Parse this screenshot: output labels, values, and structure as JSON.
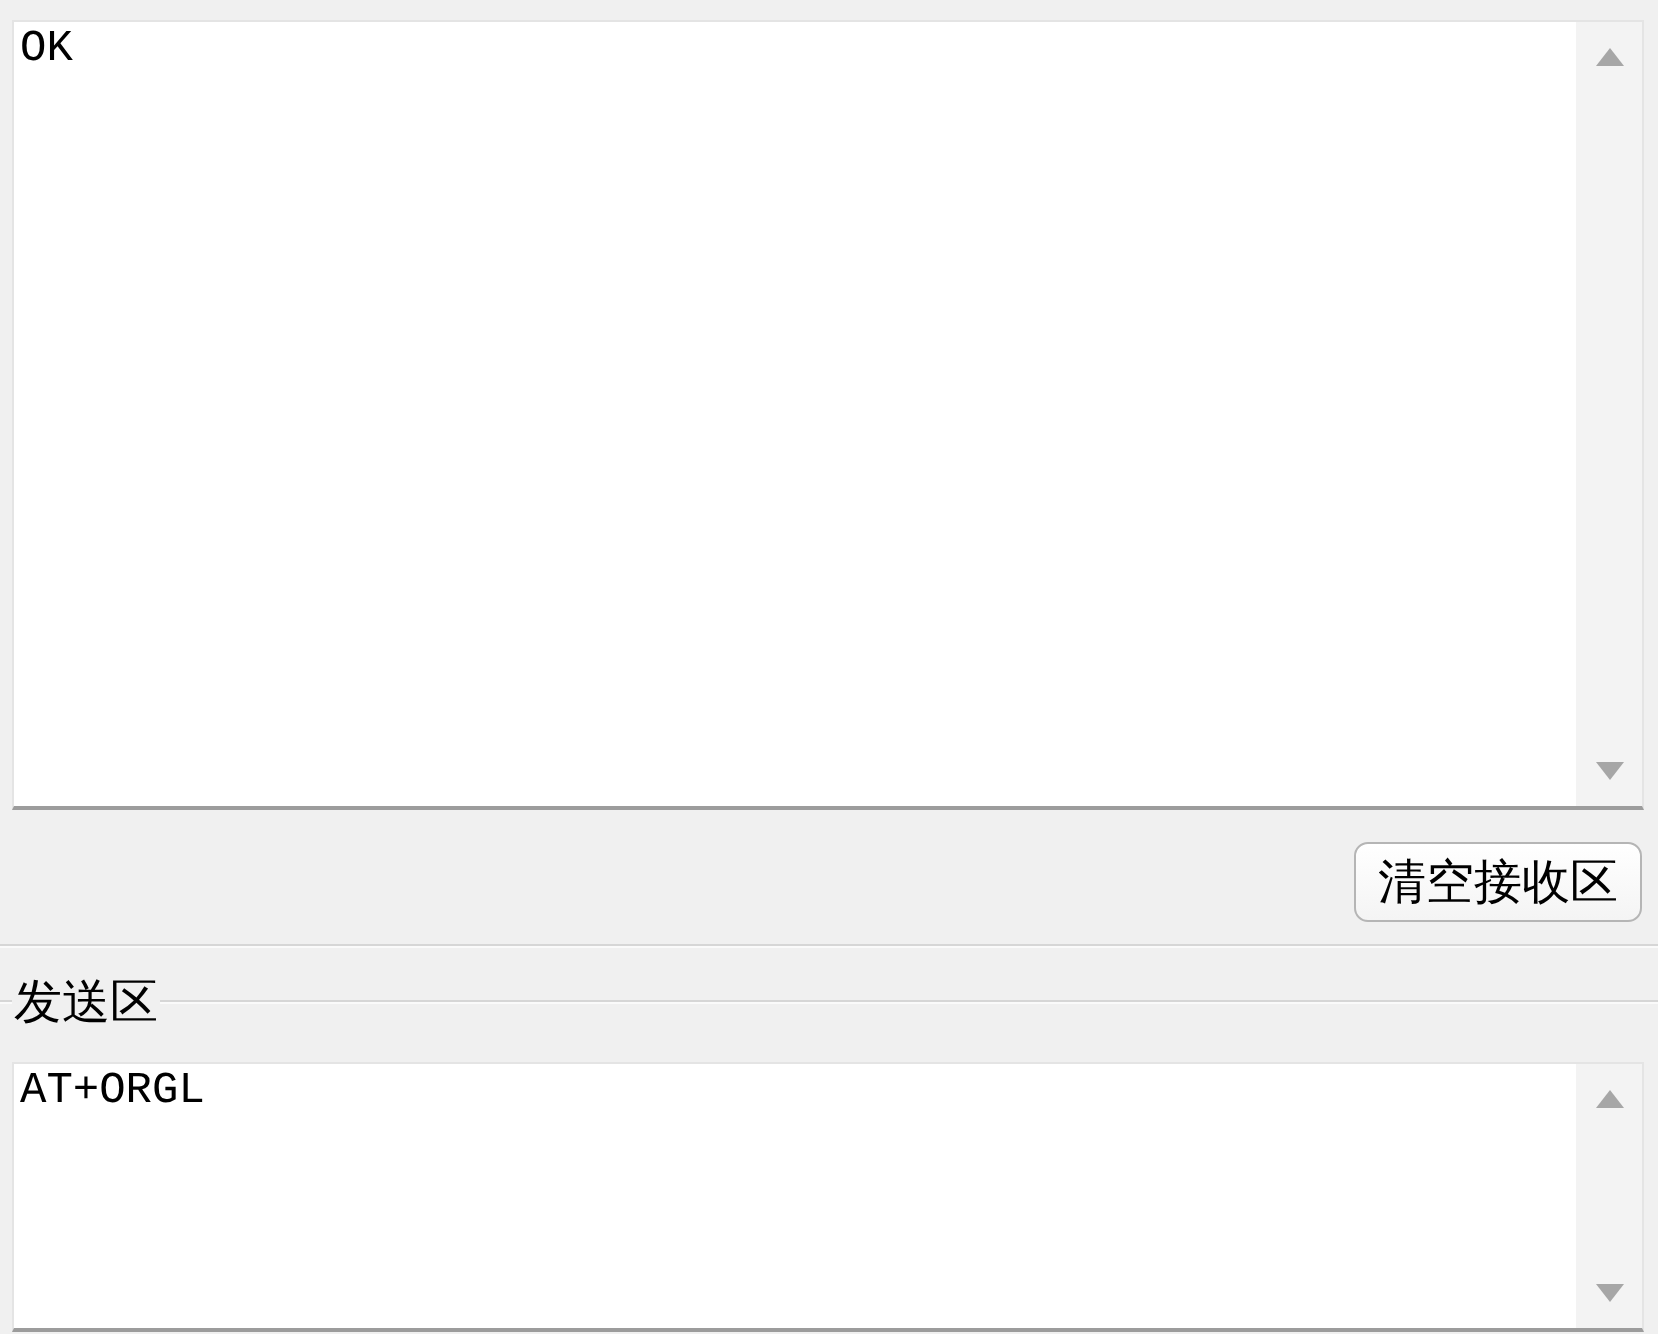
{
  "receive_area": {
    "value": "OK"
  },
  "clear_receive_button": {
    "label": "清空接收区"
  },
  "send_area": {
    "title": "发送区",
    "value": "AT+ORGL"
  }
}
